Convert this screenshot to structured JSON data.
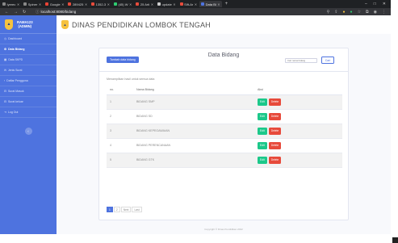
{
  "browser": {
    "tabs": [
      {
        "label": "Iyerec",
        "color": "#888888"
      },
      {
        "label": "Spiner",
        "color": "#888888"
      },
      {
        "label": "Google",
        "color": "#ea4335"
      },
      {
        "label": "289425",
        "color": "#e74c3c"
      },
      {
        "label": "1352-3",
        "color": "#e74c3c"
      },
      {
        "label": "(45) W",
        "color": "#2ecc71"
      },
      {
        "label": "25 Arti",
        "color": "#e74c3c"
      },
      {
        "label": "update",
        "color": "#cccccc"
      },
      {
        "label": "Sift-Ar",
        "color": "#e74c3c"
      },
      {
        "label": "Data Bi",
        "color": "#4e73df"
      }
    ],
    "new_tab": "+",
    "url": "localhost:8080/bidang",
    "window_controls": [
      "–",
      "□",
      "✕"
    ]
  },
  "sidebar": {
    "brand_line1": "RAMA123",
    "brand_line2": "(ADMIN)",
    "items": [
      {
        "label": "Dashboard"
      },
      {
        "label": "Data Bidang"
      },
      {
        "label": "Data SKPD"
      },
      {
        "label": "Jenis Surat"
      },
      {
        "label": "Daftar Pengguna"
      },
      {
        "label": "Surat Masuk"
      },
      {
        "label": "Surat keluar"
      },
      {
        "label": "Log Out"
      }
    ],
    "toggle_icon": "‹"
  },
  "header": {
    "title": "DINAS PENDIDIKAN LOMBOK TENGAH"
  },
  "card": {
    "add_button": "Tambah data bidang",
    "title": "Data Bidang",
    "search_placeholder": "Cari nama bidang",
    "search_button": "Cari",
    "info_text": "Menampilkan hasil untuk semua data",
    "columns": [
      "no.",
      "Nama Bidang",
      "Aksi"
    ],
    "rows": [
      {
        "no": "1",
        "name": "BIDANG SMP"
      },
      {
        "no": "2",
        "name": "BIDANG SD"
      },
      {
        "no": "3",
        "name": "BIDANG KEPEGAWAIAN"
      },
      {
        "no": "4",
        "name": "BIDANG PERENCANAAN"
      },
      {
        "no": "5",
        "name": "BIDANG GTK"
      }
    ],
    "edit_label": "Edit",
    "delete_label": "Delete",
    "pagination": [
      "1",
      "2",
      "Next",
      "Last"
    ]
  },
  "footer": "Copyright © Dinas Pendidikan 2022",
  "colors": {
    "primary": "#4e73df",
    "success": "#1cc88a",
    "danger": "#e74a3b",
    "brand_gold": "#f6c23e"
  }
}
